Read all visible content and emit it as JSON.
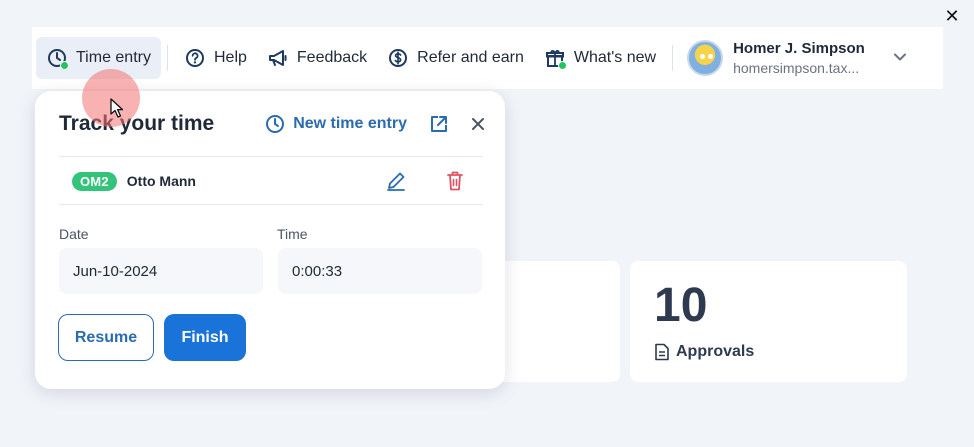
{
  "window": {
    "close_glyph": "✕"
  },
  "topbar": {
    "items": [
      {
        "label": "Time entry",
        "icon": "clock-icon",
        "active": true
      },
      {
        "label": "Help",
        "icon": "help-circle-icon"
      },
      {
        "label": "Feedback",
        "icon": "megaphone-icon"
      },
      {
        "label": "Refer and earn",
        "icon": "dollar-circle-icon"
      },
      {
        "label": "What's new",
        "icon": "gift-icon"
      }
    ],
    "profile": {
      "name": "Homer J. Simpson",
      "email": "homersimpson.tax..."
    }
  },
  "dashboard": {
    "approvals": {
      "count": "10",
      "label": "Approvals"
    }
  },
  "popup": {
    "title": "Track your time",
    "new_entry_label": "New time entry",
    "client": {
      "badge": "OM2",
      "name": "Otto Mann"
    },
    "date": {
      "label": "Date",
      "value": "Jun-10-2024"
    },
    "time": {
      "label": "Time",
      "value": "0:00:33"
    },
    "resume_label": "Resume",
    "finish_label": "Finish"
  },
  "colors": {
    "accent": "#1a73d9",
    "link": "#2b6cb0",
    "badge_green": "#34c37a",
    "status_green": "#22c55e",
    "delete_red": "#e05263"
  }
}
